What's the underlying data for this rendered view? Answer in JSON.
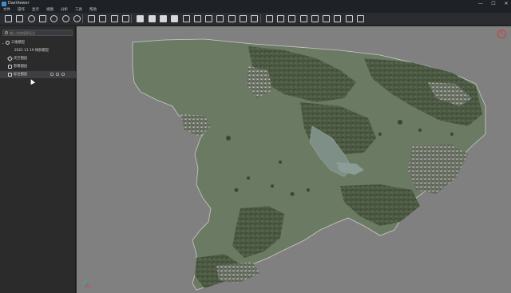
{
  "window": {
    "title": "DasViewer",
    "controls": {
      "minimize": "—",
      "maximize": "☐",
      "close": "✕"
    }
  },
  "menu": [
    "文件",
    "操作",
    "显示",
    "视图",
    "分析",
    "工具",
    "帮助"
  ],
  "toolbar": {
    "groups": [
      [
        "new-file-icon",
        "open-folder-icon",
        "cloud-icon",
        "save-icon",
        "refresh-icon",
        "settings-icon",
        "close-circle-icon"
      ],
      [
        "crosshair-icon",
        "layout-icon",
        "search-icon",
        "flag-icon"
      ],
      [
        "cube-front-icon",
        "cube-top-icon",
        "cube-side-icon",
        "cube-iso-icon",
        "grid-icon",
        "ruler-icon",
        "measure-icon",
        "lasso-icon",
        "camera-icon",
        "screenshot-icon",
        "crop-icon"
      ],
      [
        "line-measure-icon",
        "pencil-icon",
        "box-icon",
        "pin-icon",
        "texture-icon",
        "layers-icon",
        "crop-region-icon",
        "tag-icon",
        "image-icon"
      ]
    ]
  },
  "panel": {
    "search_placeholder": "输入名称搜索标注",
    "tree": {
      "root_label": "三维模型",
      "child_label": "2021 11 19 倾斜模型",
      "items": [
        {
          "label": "天空图层",
          "icon": "sky-layer-icon"
        },
        {
          "label": "影像图层",
          "icon": "image-layer-icon"
        },
        {
          "label": "标注图层",
          "icon": "annotation-layer-icon"
        }
      ]
    }
  },
  "viewport": {
    "background": "#808080",
    "model_base_color": "#6b7a62",
    "compass_color": "#d23a3a",
    "axis_colors": {
      "x": "#e04040",
      "y": "#40c040",
      "z": "#4060e0"
    }
  }
}
